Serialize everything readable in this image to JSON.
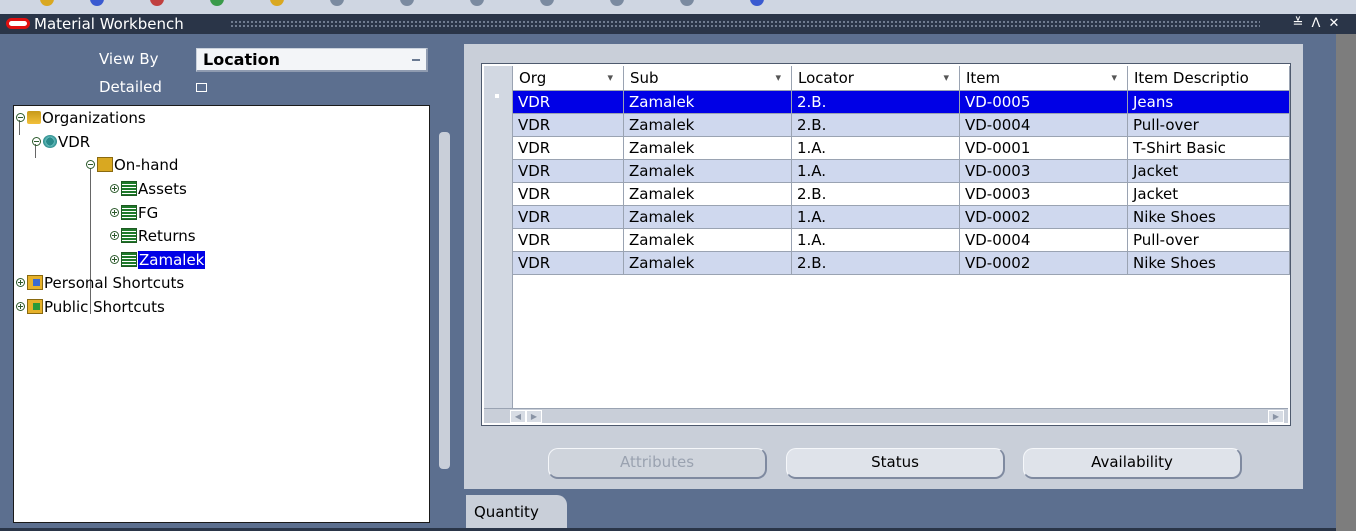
{
  "window": {
    "title": "Material Workbench",
    "minimize_glyph": "≚",
    "maximize_glyph": "ᐱ",
    "close_glyph": "✕"
  },
  "filters": {
    "view_by_label": "View By",
    "view_by_value": "Location",
    "detailed_label": "Detailed",
    "detailed_checked": false
  },
  "tree": {
    "organizations": "Organizations",
    "org": "VDR",
    "on_hand": "On-hand",
    "children": [
      "Assets",
      "FG",
      "Returns",
      "Zamalek"
    ],
    "selected": "Zamalek",
    "personal_shortcuts": "Personal Shortcuts",
    "public_shortcuts": "Public Shortcuts"
  },
  "grid": {
    "columns": [
      "Org",
      "Sub",
      "Locator",
      "Item",
      "Item Descriptio"
    ],
    "rows": [
      [
        "VDR",
        "Zamalek",
        "2.B.",
        "VD-0005",
        "Jeans"
      ],
      [
        "VDR",
        "Zamalek",
        "2.B.",
        "VD-0004",
        "Pull-over"
      ],
      [
        "VDR",
        "Zamalek",
        "1.A.",
        "VD-0001",
        "T-Shirt Basic"
      ],
      [
        "VDR",
        "Zamalek",
        "1.A.",
        "VD-0003",
        "Jacket"
      ],
      [
        "VDR",
        "Zamalek",
        "2.B.",
        "VD-0003",
        "Jacket"
      ],
      [
        "VDR",
        "Zamalek",
        "1.A.",
        "VD-0002",
        "Nike Shoes"
      ],
      [
        "VDR",
        "Zamalek",
        "1.A.",
        "VD-0004",
        "Pull-over"
      ],
      [
        "VDR",
        "Zamalek",
        "2.B.",
        "VD-0002",
        "Nike Shoes"
      ]
    ],
    "selected_row": 0
  },
  "buttons": {
    "attributes": "Attributes",
    "status": "Status",
    "availability": "Availability",
    "attributes_enabled": false
  },
  "tabs": {
    "quantity": "Quantity"
  },
  "colors": {
    "background": "#5c6f8f",
    "title_bar": "#2a3548",
    "selection": "#0000e6",
    "panel": "#c9cfd9",
    "alt_row": "#cfd8ee"
  }
}
